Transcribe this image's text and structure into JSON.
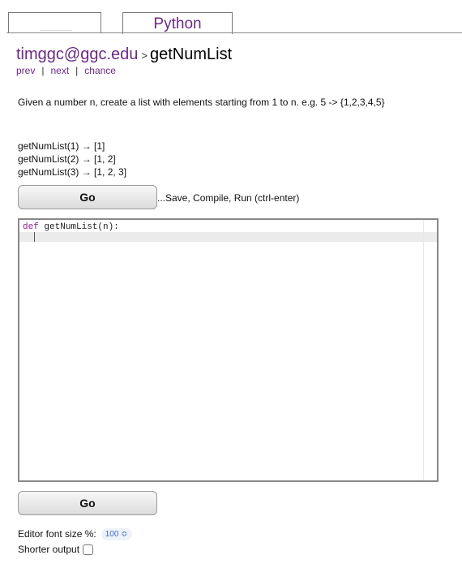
{
  "tabs": {
    "active": "Python"
  },
  "header": {
    "user": "timggc@ggc.edu",
    "separator": ">",
    "problem": "getNumList"
  },
  "nav": {
    "prev": "prev",
    "next": "next",
    "chance": "chance",
    "divider": "|"
  },
  "description": "Given a number n, create a list with elements starting from 1 to n. e.g. 5 -> {1,2,3,4,5}",
  "examples": [
    "getNumList(1) → [1]",
    "getNumList(2) → [1, 2]",
    "getNumList(3) → [1, 2, 3]"
  ],
  "buttons": {
    "go_label": "Go"
  },
  "save_hint": "...Save, Compile, Run (ctrl-enter)",
  "editor": {
    "keyword": "def",
    "signature": " getNumList(n):"
  },
  "settings": {
    "font_size_label": "Editor font size %:",
    "font_size_value": "100 ≎",
    "shorter_output_label": "Shorter output",
    "shorter_output_checked": false
  }
}
